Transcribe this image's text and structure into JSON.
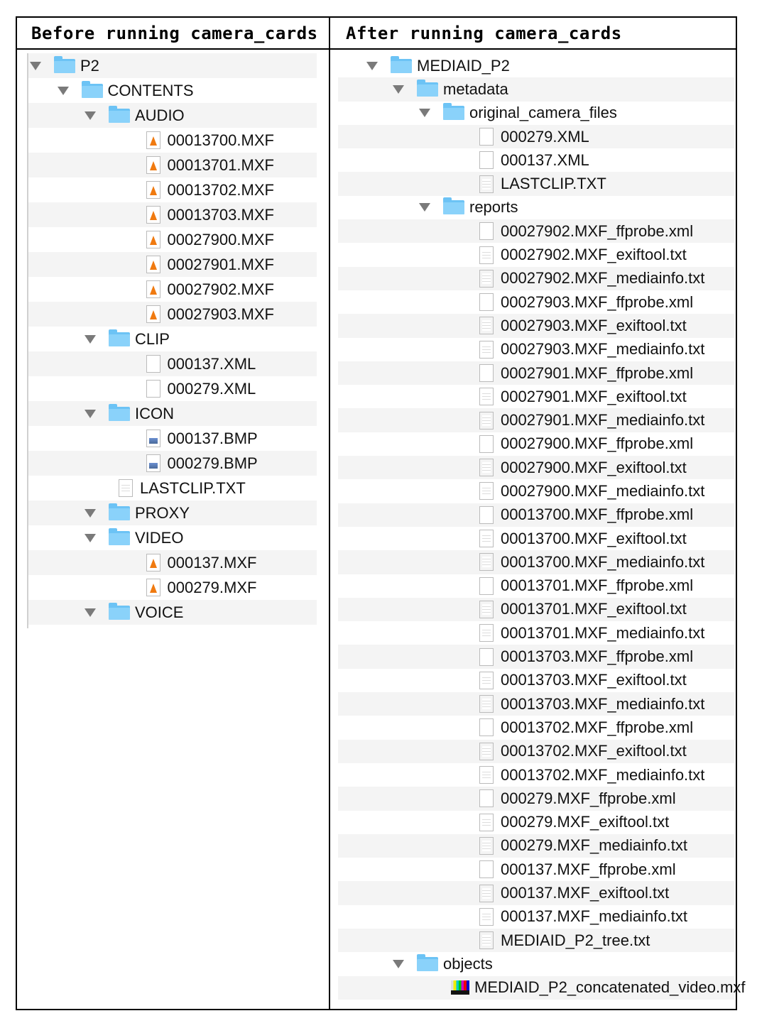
{
  "headers": {
    "before": "Before running camera_cards",
    "after": "After running camera_cards"
  },
  "before_tree": [
    {
      "name": "P2",
      "level": 0,
      "icon": "folder",
      "expanded": true
    },
    {
      "name": "CONTENTS",
      "level": 1,
      "icon": "folder",
      "expanded": true
    },
    {
      "name": "AUDIO",
      "level": 2,
      "icon": "folder",
      "expanded": true
    },
    {
      "name": "00013700.MXF",
      "level": 3,
      "icon": "vlc-media-file"
    },
    {
      "name": "00013701.MXF",
      "level": 3,
      "icon": "vlc-media-file"
    },
    {
      "name": "00013702.MXF",
      "level": 3,
      "icon": "vlc-media-file"
    },
    {
      "name": "00013703.MXF",
      "level": 3,
      "icon": "vlc-media-file"
    },
    {
      "name": "00027900.MXF",
      "level": 3,
      "icon": "vlc-media-file"
    },
    {
      "name": "00027901.MXF",
      "level": 3,
      "icon": "vlc-media-file"
    },
    {
      "name": "00027902.MXF",
      "level": 3,
      "icon": "vlc-media-file"
    },
    {
      "name": "00027903.MXF",
      "level": 3,
      "icon": "vlc-media-file"
    },
    {
      "name": "CLIP",
      "level": 2,
      "icon": "folder",
      "expanded": true
    },
    {
      "name": "000137.XML",
      "level": 3,
      "icon": "blank-document"
    },
    {
      "name": "000279.XML",
      "level": 3,
      "icon": "blank-document"
    },
    {
      "name": "ICON",
      "level": 2,
      "icon": "folder",
      "expanded": true
    },
    {
      "name": "000137.BMP",
      "level": 3,
      "icon": "image-file"
    },
    {
      "name": "000279.BMP",
      "level": 3,
      "icon": "image-file"
    },
    {
      "name": "LASTCLIP.TXT",
      "level": 2,
      "icon": "text-document"
    },
    {
      "name": "PROXY",
      "level": 2,
      "icon": "folder",
      "expanded": true
    },
    {
      "name": "VIDEO",
      "level": 2,
      "icon": "folder",
      "expanded": true
    },
    {
      "name": "000137.MXF",
      "level": 3,
      "icon": "vlc-media-file"
    },
    {
      "name": "000279.MXF",
      "level": 3,
      "icon": "vlc-media-file"
    },
    {
      "name": "VOICE",
      "level": 2,
      "icon": "folder",
      "expanded": true
    }
  ],
  "after_tree": [
    {
      "name": "MEDIAID_P2",
      "level": 0,
      "icon": "folder",
      "expanded": true
    },
    {
      "name": "metadata",
      "level": 1,
      "icon": "folder",
      "expanded": true
    },
    {
      "name": "original_camera_files",
      "level": 2,
      "icon": "folder",
      "expanded": true
    },
    {
      "name": "000279.XML",
      "level": 3,
      "icon": "blank-document"
    },
    {
      "name": "000137.XML",
      "level": 3,
      "icon": "blank-document"
    },
    {
      "name": "LASTCLIP.TXT",
      "level": 3,
      "icon": "text-document"
    },
    {
      "name": "reports",
      "level": 2,
      "icon": "folder",
      "expanded": true
    },
    {
      "name": "00027902.MXF_ffprobe.xml",
      "level": 3,
      "icon": "blank-document"
    },
    {
      "name": "00027902.MXF_exiftool.txt",
      "level": 3,
      "icon": "text-document"
    },
    {
      "name": "00027902.MXF_mediainfo.txt",
      "level": 3,
      "icon": "text-document"
    },
    {
      "name": "00027903.MXF_ffprobe.xml",
      "level": 3,
      "icon": "blank-document"
    },
    {
      "name": "00027903.MXF_exiftool.txt",
      "level": 3,
      "icon": "text-document"
    },
    {
      "name": "00027903.MXF_mediainfo.txt",
      "level": 3,
      "icon": "text-document"
    },
    {
      "name": "00027901.MXF_ffprobe.xml",
      "level": 3,
      "icon": "blank-document"
    },
    {
      "name": "00027901.MXF_exiftool.txt",
      "level": 3,
      "icon": "text-document"
    },
    {
      "name": "00027901.MXF_mediainfo.txt",
      "level": 3,
      "icon": "text-document"
    },
    {
      "name": "00027900.MXF_ffprobe.xml",
      "level": 3,
      "icon": "blank-document"
    },
    {
      "name": "00027900.MXF_exiftool.txt",
      "level": 3,
      "icon": "text-document"
    },
    {
      "name": "00027900.MXF_mediainfo.txt",
      "level": 3,
      "icon": "text-document"
    },
    {
      "name": "00013700.MXF_ffprobe.xml",
      "level": 3,
      "icon": "blank-document"
    },
    {
      "name": "00013700.MXF_exiftool.txt",
      "level": 3,
      "icon": "text-document"
    },
    {
      "name": "00013700.MXF_mediainfo.txt",
      "level": 3,
      "icon": "text-document"
    },
    {
      "name": "00013701.MXF_ffprobe.xml",
      "level": 3,
      "icon": "blank-document"
    },
    {
      "name": "00013701.MXF_exiftool.txt",
      "level": 3,
      "icon": "text-document"
    },
    {
      "name": "00013701.MXF_mediainfo.txt",
      "level": 3,
      "icon": "text-document"
    },
    {
      "name": "00013703.MXF_ffprobe.xml",
      "level": 3,
      "icon": "blank-document"
    },
    {
      "name": "00013703.MXF_exiftool.txt",
      "level": 3,
      "icon": "text-document"
    },
    {
      "name": "00013703.MXF_mediainfo.txt",
      "level": 3,
      "icon": "text-document"
    },
    {
      "name": "00013702.MXF_ffprobe.xml",
      "level": 3,
      "icon": "blank-document"
    },
    {
      "name": "00013702.MXF_exiftool.txt",
      "level": 3,
      "icon": "text-document"
    },
    {
      "name": "00013702.MXF_mediainfo.txt",
      "level": 3,
      "icon": "text-document"
    },
    {
      "name": "000279.MXF_ffprobe.xml",
      "level": 3,
      "icon": "blank-document"
    },
    {
      "name": "000279.MXF_exiftool.txt",
      "level": 3,
      "icon": "text-document"
    },
    {
      "name": "000279.MXF_mediainfo.txt",
      "level": 3,
      "icon": "text-document"
    },
    {
      "name": "000137.MXF_ffprobe.xml",
      "level": 3,
      "icon": "blank-document"
    },
    {
      "name": "000137.MXF_exiftool.txt",
      "level": 3,
      "icon": "text-document"
    },
    {
      "name": "000137.MXF_mediainfo.txt",
      "level": 3,
      "icon": "text-document"
    },
    {
      "name": "MEDIAID_P2_tree.txt",
      "level": 3,
      "icon": "text-document"
    },
    {
      "name": "objects",
      "level": 1,
      "icon": "folder",
      "expanded": true
    },
    {
      "name": "MEDIAID_P2_concatenated_video.mxf",
      "level": 2,
      "icon": "video-file"
    }
  ]
}
